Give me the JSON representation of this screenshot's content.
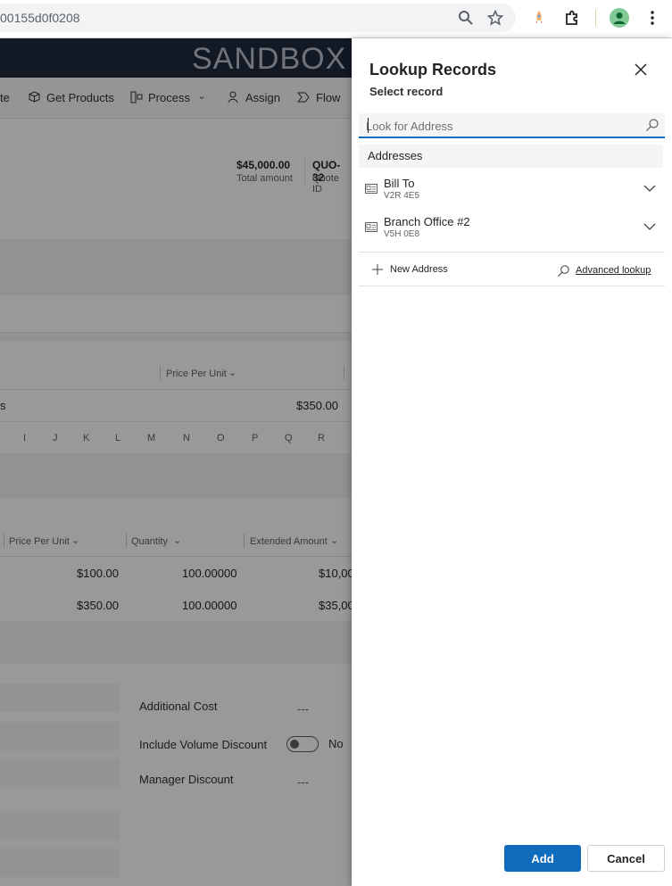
{
  "browser": {
    "url": "00155d0f0208"
  },
  "app": {
    "env_label": "SANDBOX",
    "commands": [
      "te",
      "Get Products",
      "Process",
      "Assign",
      "Flow"
    ],
    "summary": {
      "total_amount": "$45,000.00",
      "total_amount_label": "Total amount",
      "quote_id": "QUO-32",
      "quote_id_label": "Quote ID"
    },
    "grid1": {
      "col_price": "Price Per Unit",
      "row_first": "s",
      "row_price": "$350.00"
    },
    "letters": [
      "I",
      "J",
      "K",
      "L",
      "M",
      "N",
      "O",
      "P",
      "Q",
      "R"
    ],
    "grid2": {
      "cols": [
        "Price Per Unit",
        "Quantity",
        "Extended Amount"
      ],
      "rows": [
        {
          "price": "$100.00",
          "qty": "100.00000",
          "ext": "$10,00"
        },
        {
          "price": "$350.00",
          "qty": "100.00000",
          "ext": "$35,00"
        }
      ]
    },
    "fields": {
      "additional_cost_label": "Additional Cost",
      "additional_cost_value": "---",
      "volume_discount_label": "Include Volume Discount",
      "volume_discount_value": "No",
      "manager_discount_label": "Manager Discount",
      "manager_discount_value": "---"
    }
  },
  "lookup": {
    "title": "Lookup Records",
    "subtitle": "Select record",
    "search_placeholder": "Look for Address",
    "group_header": "Addresses",
    "records": [
      {
        "name": "Bill To",
        "sub": "V2R 4E5"
      },
      {
        "name": "Branch Office #2",
        "sub": "V5H 0E8"
      }
    ],
    "new_label": "New Address",
    "advanced_label": "Advanced lookup",
    "add_label": "Add",
    "cancel_label": "Cancel"
  },
  "colors": {
    "primary": "#0f6cbd",
    "header_dark": "#1f2a3c"
  }
}
